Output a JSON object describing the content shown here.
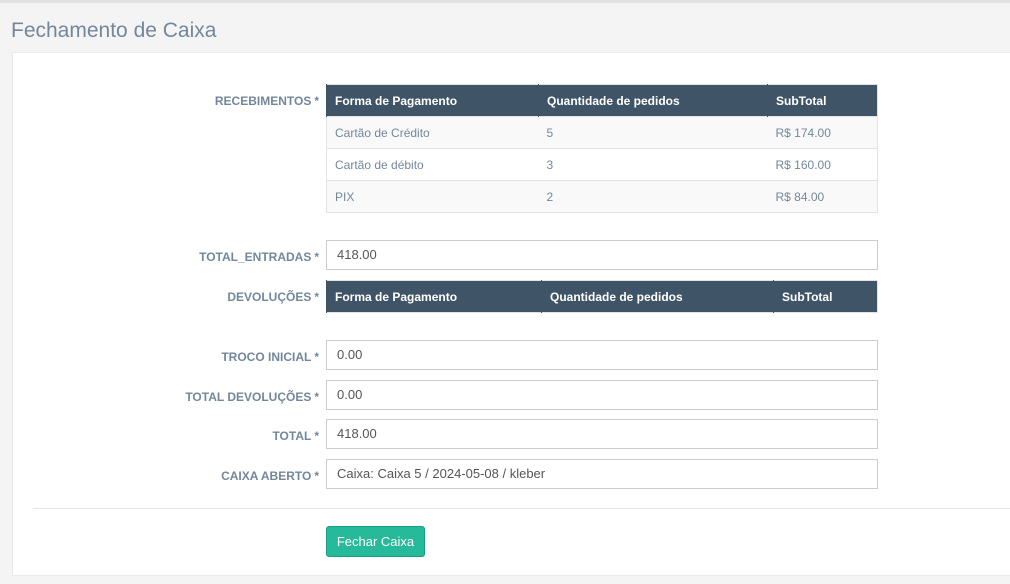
{
  "page": {
    "title": "Fechamento de Caixa"
  },
  "required_mark": "*",
  "recebimentos": {
    "label": "RECEBIMENTOS",
    "columns": [
      "Forma de Pagamento",
      "Quantidade de pedidos",
      "SubTotal"
    ],
    "rows": [
      {
        "forma": "Cartão de Crédito",
        "quantidade": "5",
        "subtotal": "R$ 174.00"
      },
      {
        "forma": "Cartão de débito",
        "quantidade": "3",
        "subtotal": "R$ 160.00"
      },
      {
        "forma": "PIX",
        "quantidade": "2",
        "subtotal": "R$ 84.00"
      }
    ]
  },
  "total_entradas": {
    "label": "TOTAL_ENTRADAS",
    "value": "418.00"
  },
  "devolucoes": {
    "label": "DEVOLUÇÕES",
    "columns": [
      "Forma de Pagamento",
      "Quantidade de pedidos",
      "SubTotal"
    ]
  },
  "troco_inicial": {
    "label": "TROCO INICIAL",
    "value": "0.00"
  },
  "total_devolucoes": {
    "label": "TOTAL DEVOLUÇÕES",
    "value": "0.00"
  },
  "total": {
    "label": "TOTAL",
    "value": "418.00"
  },
  "caixa_aberto": {
    "label": "CAIXA ABERTO",
    "value": "Caixa: Caixa 5 / 2024-05-08 / kleber"
  },
  "actions": {
    "submit_label": "Fechar Caixa"
  },
  "colors": {
    "header_bg": "#405467",
    "button_bg": "#26b99a",
    "label_color": "#73879c"
  }
}
